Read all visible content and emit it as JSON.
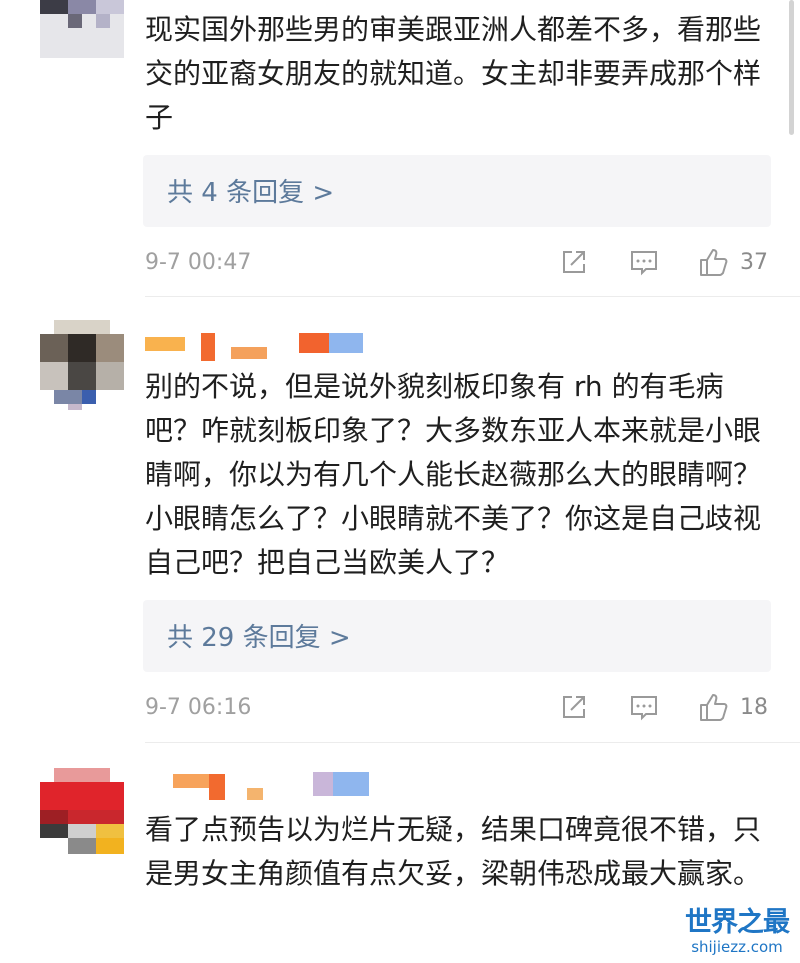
{
  "comments": [
    {
      "text": "现实国外那些男的审美跟亚洲人都差不多，看那些交的亚裔女朋友的就知道。女主却非要弄成那个样子",
      "replies_label": "共 4 条回复 >",
      "time": "9-7 00:47",
      "likes": "37"
    },
    {
      "text": "别的不说，但是说外貌刻板印象有 rh 的有毛病吧？咋就刻板印象了？大多数东亚人本来就是小眼睛啊，你以为有几个人能长赵薇那么大的眼睛啊？小眼睛怎么了？小眼睛就不美了？你这是自己歧视自己吧？把自己当欧美人了？",
      "replies_label": "共 29 条回复 >",
      "time": "9-7 06:16",
      "likes": "18"
    },
    {
      "text": "看了点预告以为烂片无疑，结果口碑竟很不错，只是男女主角颜值有点欠妥，梁朝伟恐成最大赢家。"
    }
  ],
  "icons": {
    "share": "share-icon",
    "comment": "comment-icon",
    "like": "thumbs-up-icon"
  },
  "colors": {
    "reply_link": "#5d7a9b",
    "reply_bg": "#f5f5f7",
    "meta_text": "#a0a0a0",
    "watermark": "#1f76c5"
  },
  "watermark": {
    "title": "世界之最",
    "url": "shijiezz.com"
  }
}
